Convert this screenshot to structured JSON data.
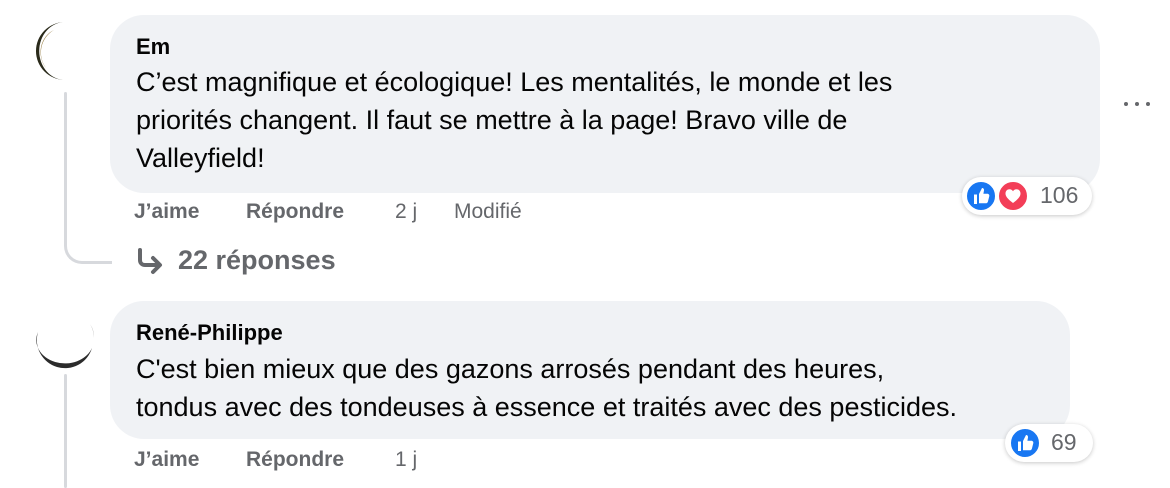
{
  "colors": {
    "bubble_bg": "#f0f2f5",
    "text_primary": "#050505",
    "text_secondary": "#65676b",
    "like_blue": "#1877f2",
    "love_red": "#f33e58",
    "thread_line": "#d7d9dd"
  },
  "comments": [
    {
      "author": "Em",
      "lines": [
        "C’est magnifique et écologique! Les mentalités, le monde et les",
        "priorités changent. Il faut se mettre à la page! Bravo ville de",
        "Valleyfield!"
      ],
      "like_label": "J’aime",
      "reply_label": "Répondre",
      "time": "2 j",
      "edited_label": "Modifié",
      "reaction_icons": [
        "like-icon",
        "love-icon"
      ],
      "reaction_count": "106",
      "more_icon": "more-options-icon"
    },
    {
      "author": "René-Philippe",
      "lines": [
        "C'est bien mieux que des gazons arrosés pendant des heures,",
        "tondus avec des tondeuses à essence et traités avec des pesticides."
      ],
      "like_label": "J’aime",
      "reply_label": "Répondre",
      "time": "1 j",
      "reaction_icons": [
        "like-icon"
      ],
      "reaction_count": "69"
    }
  ],
  "replies_toggle": {
    "icon": "reply-arrow-icon",
    "label": "22 réponses"
  }
}
